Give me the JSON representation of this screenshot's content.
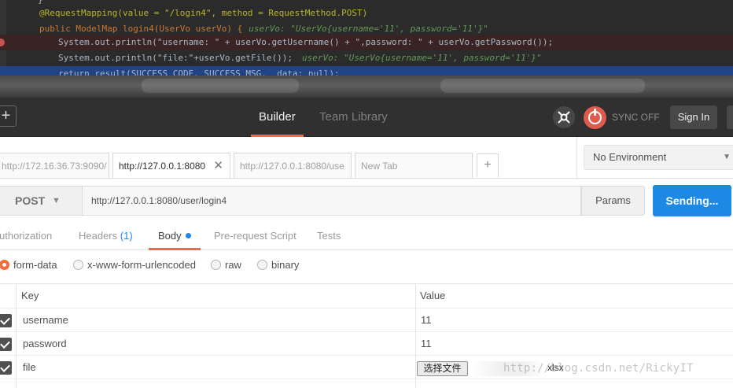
{
  "ide": {
    "line1": "@RequestMapping(value = \"/login4\", method = RequestMethod.POST)",
    "line2_code": "public ModelMap login4(UserVo userVo) {",
    "line2_hint": "userVo: \"UserVo{username='11', password='11'}\"",
    "line3": "System.out.println(\"username: \" + userVo.getUsername() + \",password: \" + userVo.getPassword());",
    "line4_code": "System.out.println(\"file:\"+userVo.getFile());",
    "line4_hint": "userVo: \"UserVo{username='11', password='11'}\"",
    "line5": "return result(SUCCESS_CODE, SUCCESS_MSG,  data: null);"
  },
  "header": {
    "builder_tab": "Builder",
    "team_library_tab": "Team Library",
    "sync_label": "SYNC OFF",
    "sign_in": "Sign In"
  },
  "tabs": [
    {
      "label": "http://172.16.36.73:9090/",
      "active": false
    },
    {
      "label": "http://127.0.0.1:8080",
      "active": true
    },
    {
      "label": "http://127.0.0.1:8080/use",
      "active": false
    },
    {
      "label": "New Tab",
      "active": false
    }
  ],
  "environment": {
    "selected": "No Environment"
  },
  "request": {
    "method": "POST",
    "url": "http://127.0.0.1:8080/user/login4",
    "params_label": "Params",
    "send_label": "Sending..."
  },
  "subtabs": {
    "authorization": "uthorization",
    "headers": "Headers",
    "headers_count": "(1)",
    "body": "Body",
    "prerequest": "Pre-request Script",
    "tests": "Tests"
  },
  "body_types": {
    "form_data": "form-data",
    "urlencoded": "x-www-form-urlencoded",
    "raw": "raw",
    "binary": "binary",
    "selected": "form-data"
  },
  "kv": {
    "key_header": "Key",
    "value_header": "Value",
    "rows": [
      {
        "key": "username",
        "value": "11",
        "checked": true
      },
      {
        "key": "password",
        "value": "11",
        "checked": true
      },
      {
        "key": "file",
        "value": "",
        "checked": true
      }
    ],
    "file_button": "选择文件",
    "file_ext": "xlsx"
  },
  "watermark": "http://blog.csdn.net/RickyIT",
  "colors": {
    "accent_orange": "#f26b3a",
    "send_blue": "#1e88e5",
    "header_dark": "#303030"
  }
}
